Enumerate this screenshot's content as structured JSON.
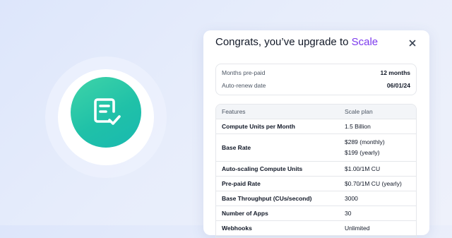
{
  "icons": {
    "badge": "document-check-icon",
    "close": "close-icon"
  },
  "colors": {
    "accent": "#7c3aed",
    "badge_green": "#20c1a8"
  },
  "dialog": {
    "title_prefix": "Congrats, you’ve upgrade to",
    "title_plan": "Scale"
  },
  "summary": [
    {
      "label": "Months pre-paid",
      "value": "12 months"
    },
    {
      "label": "Auto-renew date",
      "value": "06/01/24"
    }
  ],
  "table": {
    "headers": [
      "Features",
      "Scale plan"
    ],
    "rows": [
      {
        "feature": "Compute Units per Month",
        "value": "1.5 Billion"
      },
      {
        "feature": "Base Rate",
        "value": "$289 (monthly)",
        "value2": "$199 (yearly)"
      },
      {
        "feature": "Auto-scaling Compute Units",
        "value": "$1.00/1M CU"
      },
      {
        "feature": "Pre-paid Rate",
        "value": "$0.70/1M CU (yearly)"
      },
      {
        "feature": "Base Throughput (CUs/second)",
        "value": "3000"
      },
      {
        "feature": "Number of Apps",
        "value": "30"
      },
      {
        "feature": "Webhooks",
        "value": "Unlimited"
      }
    ]
  }
}
